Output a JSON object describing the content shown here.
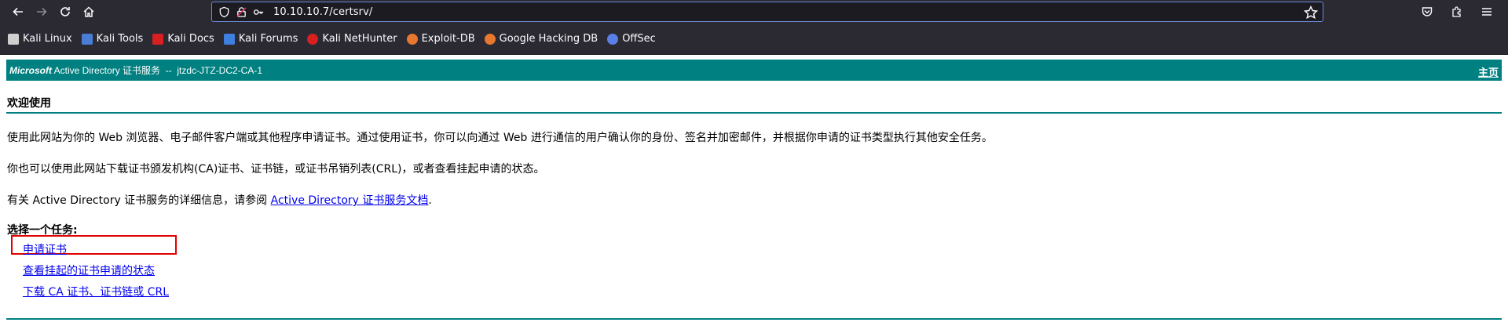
{
  "browser": {
    "url": "10.10.10.7/certsrv/",
    "bookmarks": [
      {
        "label": "Kali Linux",
        "color": "#cfcfcf"
      },
      {
        "label": "Kali Tools",
        "color": "#4a7dd6"
      },
      {
        "label": "Kali Docs",
        "color": "#d82020"
      },
      {
        "label": "Kali Forums",
        "color": "#3f7fe0"
      },
      {
        "label": "Kali NetHunter",
        "color": "#d82020"
      },
      {
        "label": "Exploit-DB",
        "color": "#e8782f"
      },
      {
        "label": "Google Hacking DB",
        "color": "#e8782f"
      },
      {
        "label": "OffSec",
        "color": "#5b7fe8"
      }
    ]
  },
  "page": {
    "banner": {
      "brand": "Microsoft",
      "title": " Active Directory 证书服务  --  jtzdc-JTZ-DC2-CA-1",
      "home_link": "主页"
    },
    "welcome": "欢迎使用",
    "para1": "使用此网站为你的 Web 浏览器、电子邮件客户端或其他程序申请证书。通过使用证书，你可以向通过 Web 进行通信的用户确认你的身份、签名并加密邮件，并根据你申请的证书类型执行其他安全任务。",
    "para2": "你也可以使用此网站下载证书颁发机构(CA)证书、证书链，或证书吊销列表(CRL)，或者查看挂起申请的状态。",
    "para3_prefix": "有关 Active Directory 证书服务的详细信息，请参阅 ",
    "para3_link": "Active Directory 证书服务文档",
    "para3_suffix": ".",
    "task_title": "选择一个任务:",
    "tasks": [
      "申请证书",
      "查看挂起的证书申请的状态",
      "下载 CA 证书、证书链或 CRL"
    ]
  },
  "colors": {
    "banner": "#008080",
    "link": "#0000ee",
    "highlight": "#e00000"
  }
}
